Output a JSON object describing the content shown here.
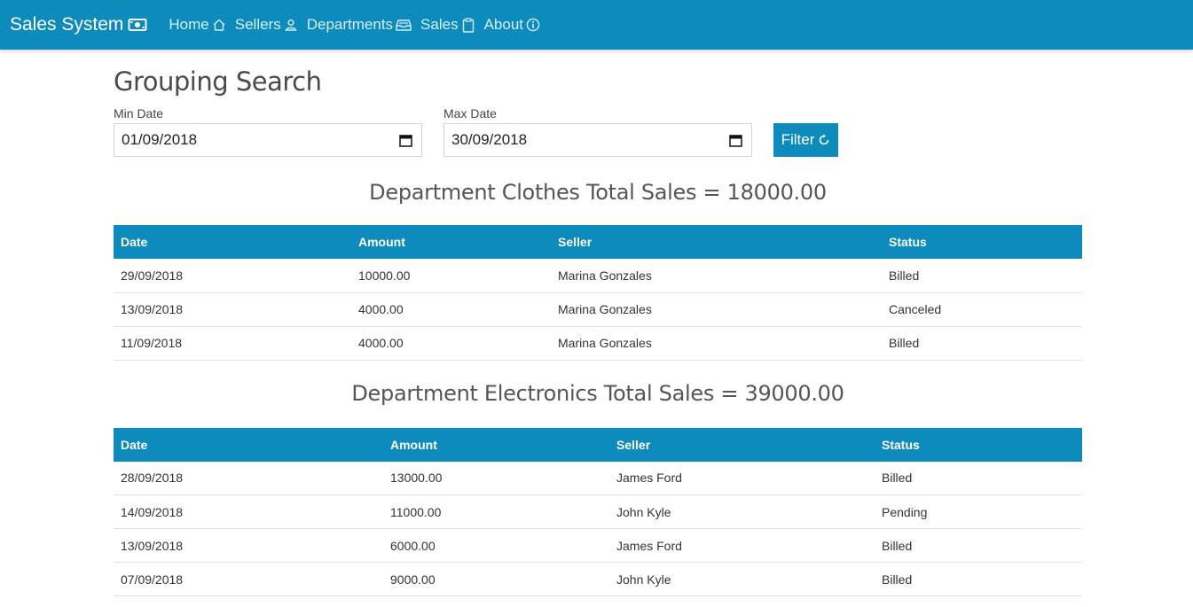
{
  "navbar": {
    "brand": "Sales System",
    "links": [
      {
        "label": "Home",
        "icon": "home-icon"
      },
      {
        "label": "Sellers",
        "icon": "person-icon"
      },
      {
        "label": "Departments",
        "icon": "inbox-icon"
      },
      {
        "label": "Sales",
        "icon": "clipboard-icon"
      },
      {
        "label": "About",
        "icon": "info-icon"
      }
    ],
    "color": "#0e8bbd"
  },
  "page_title": "Grouping Search",
  "filter": {
    "min_label": "Min Date",
    "min_value": "01/09/2018",
    "max_label": "Max Date",
    "max_value": "30/09/2018",
    "button_label": "Filter"
  },
  "groups": [
    {
      "title": "Department Clothes Total Sales = 18000.00",
      "headers": [
        "Date",
        "Amount",
        "Seller",
        "Status"
      ],
      "rows": [
        [
          "29/09/2018",
          "10000.00",
          "Marina Gonzales",
          "Billed"
        ],
        [
          "13/09/2018",
          "4000.00",
          "Marina Gonzales",
          "Canceled"
        ],
        [
          "11/09/2018",
          "4000.00",
          "Marina Gonzales",
          "Billed"
        ]
      ]
    },
    {
      "title": "Department Electronics Total Sales = 39000.00",
      "headers": [
        "Date",
        "Amount",
        "Seller",
        "Status"
      ],
      "rows": [
        [
          "28/09/2018",
          "13000.00",
          "James Ford",
          "Billed"
        ],
        [
          "14/09/2018",
          "11000.00",
          "John Kyle",
          "Pending"
        ],
        [
          "13/09/2018",
          "6000.00",
          "James Ford",
          "Billed"
        ],
        [
          "07/09/2018",
          "9000.00",
          "John Kyle",
          "Billed"
        ]
      ]
    }
  ]
}
